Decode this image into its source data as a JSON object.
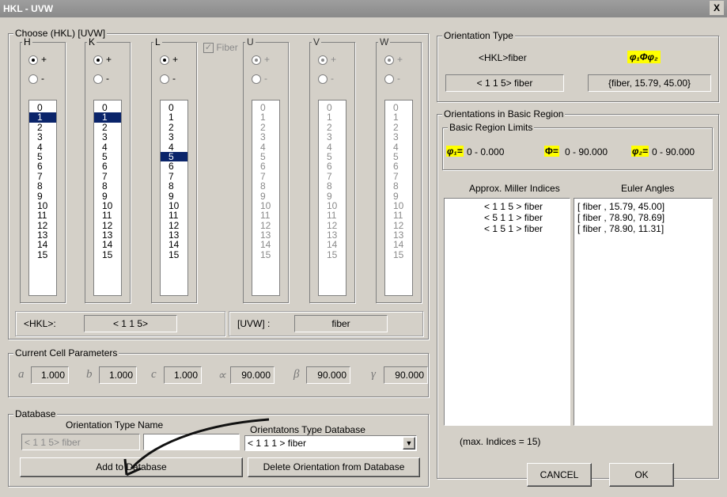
{
  "window": {
    "title": "HKL - UVW",
    "close": "X"
  },
  "choose": {
    "legend": "Choose (HKL) [UVW]",
    "columns": [
      {
        "label": "H",
        "plus": "+",
        "minus": "-",
        "selected": 1,
        "enabled": true
      },
      {
        "label": "K",
        "plus": "+",
        "minus": "-",
        "selected": 1,
        "enabled": true
      },
      {
        "label": "L",
        "plus": "+",
        "minus": "-",
        "selected": 5,
        "enabled": true
      },
      {
        "label": "U",
        "plus": "+",
        "minus": "-",
        "selected": null,
        "enabled": false
      },
      {
        "label": "V",
        "plus": "+",
        "minus": "-",
        "selected": null,
        "enabled": false
      },
      {
        "label": "W",
        "plus": "+",
        "minus": "-",
        "selected": null,
        "enabled": false
      }
    ],
    "values": [
      "0",
      "1",
      "2",
      "3",
      "4",
      "5",
      "6",
      "7",
      "8",
      "9",
      "10",
      "11",
      "12",
      "13",
      "14",
      "15"
    ],
    "fiber_label": "Fiber",
    "hkl_label": "<HKL>:",
    "hkl_value": "< 1  1  5>",
    "uvw_label": "[UVW] :",
    "uvw_value": "fiber"
  },
  "cell": {
    "legend": "Current Cell Parameters",
    "params": [
      {
        "sym": "a",
        "value": "1.000"
      },
      {
        "sym": "b",
        "value": "1.000"
      },
      {
        "sym": "c",
        "value": "1.000"
      },
      {
        "sym": "∝",
        "value": "90.000"
      },
      {
        "sym": "β",
        "value": "90.000"
      },
      {
        "sym": "γ",
        "value": "90.000"
      }
    ]
  },
  "database": {
    "legend": "Database",
    "name_label": "Orientation Type Name",
    "db_label": "Orientatons Type Database",
    "name_value": "< 1  1  5> fiber",
    "name_input": "",
    "db_value": "< 1  1  1 > fiber",
    "add_button": "Add to Database",
    "delete_button": "Delete Orientation from Database"
  },
  "orientation_type": {
    "legend": "Orientation Type",
    "hkl_fiber": "<HKL>fiber",
    "euler_symbols": "φ₁Φφ₂",
    "miller_value": "< 1  1  5> fiber",
    "euler_value": "{fiber,  15.79,  45.00}"
  },
  "basic_region": {
    "legend": "Orientations in Basic Region",
    "limits_legend": "Basic Region Limits",
    "phi1_sym": "φ₁=",
    "phi1_range": "0 -    0.000",
    "Phi_sym": "Φ=",
    "Phi_range": "0 -   90.000",
    "phi2_sym": "φ₂=",
    "phi2_range": "0 -   90.000",
    "miller_header": "Approx. Miller Indices",
    "euler_header": "Euler Angles",
    "miller_items": [
      "< 1  1  5 > fiber",
      "< 5  1  1 > fiber",
      "< 1  5  1 > fiber"
    ],
    "euler_items": [
      "[ fiber ,  15.79,  45.00]",
      "[ fiber ,  78.90,  78.69]",
      "[ fiber ,  78.90,  11.31]"
    ],
    "max_indices": "(max. Indices = 15)"
  },
  "buttons": {
    "cancel": "CANCEL",
    "ok": "OK"
  }
}
